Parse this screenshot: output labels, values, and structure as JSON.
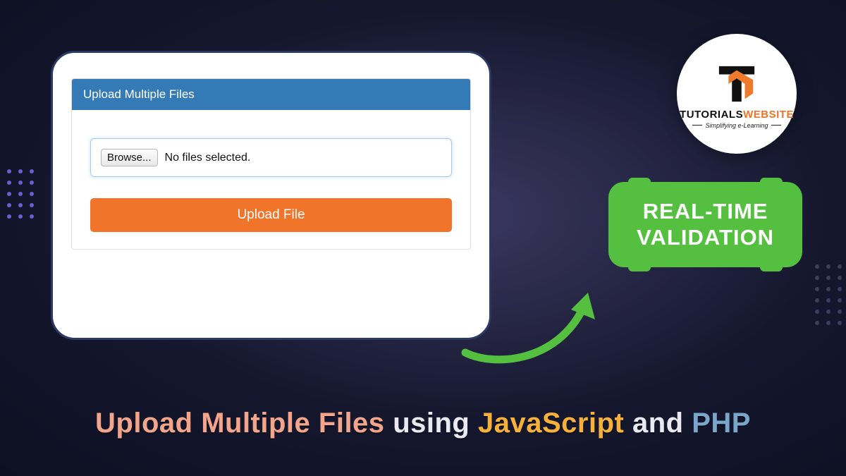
{
  "logo": {
    "brand_left": "TUTORIALS",
    "brand_right": "WEBSITE",
    "tagline": "Simplifying e-Learning"
  },
  "card": {
    "panel_title": "Upload Multiple Files",
    "browse_label": "Browse...",
    "file_status": "No files selected.",
    "submit_label": "Upload File"
  },
  "callout": {
    "line1": "REAL-TIME",
    "line2": "VALIDATION"
  },
  "title": {
    "part_upload": "Upload Multiple Files",
    "part_using": "using",
    "part_js": "JavaScript",
    "part_and": "and",
    "part_php": "PHP"
  },
  "colors": {
    "panel_header": "#337ab7",
    "submit_button": "#f0752a",
    "callout": "#55c040",
    "arrow": "#55c040"
  }
}
